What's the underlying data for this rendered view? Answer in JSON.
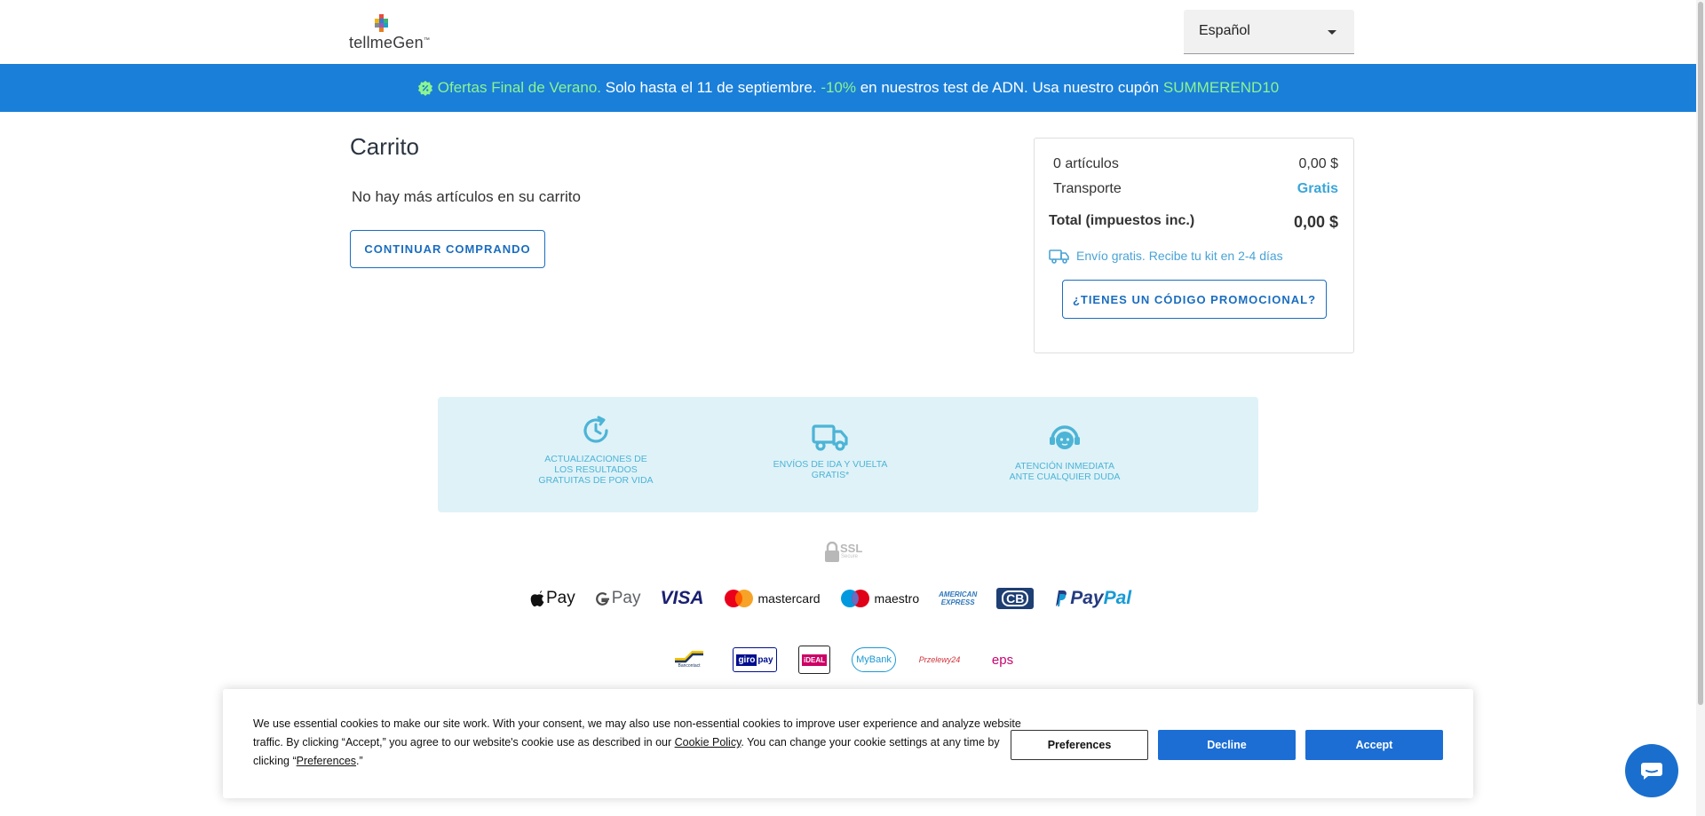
{
  "header": {
    "logo_text": "tellmeGen",
    "logo_tm": "™",
    "language": {
      "selected": "Español"
    }
  },
  "banner": {
    "icon": "percent-badge-icon",
    "highlight": "Ofertas Final de Verano.",
    "text1": " Solo hasta el 11 de septiembre. ",
    "discount": "-10%",
    "text2": " en nuestros test de ADN. Usa nuestro cupón ",
    "coupon": "SUMMEREND10",
    "colors": {
      "background": "#1a7fd9",
      "accent": "#8bf58f"
    }
  },
  "cart": {
    "title": "Carrito",
    "empty_message": "No hay más artículos en su carrito",
    "continue_label": "CONTINUAR COMPRANDO"
  },
  "summary": {
    "items_label": "0 artículos",
    "items_value": "0,00 $",
    "shipping_label": "Transporte",
    "shipping_value": "Gratis",
    "total_label": "Total (impuestos inc.)",
    "total_value": "0,00 $",
    "shipping_note": "Envío gratis. Recibe tu kit en 2-4 días",
    "promo_label": "¿TIENES UN CÓDIGO PROMOCIONAL?"
  },
  "features": [
    {
      "icon": "clock-refresh-icon",
      "line1": "ACTUALIZACIONES DE",
      "line2": "LOS RESULTADOS",
      "line3": "GRATUITAS DE POR VIDA"
    },
    {
      "icon": "truck-icon",
      "line1": "ENVÍOS DE IDA Y VUELTA",
      "line2": "GRATIS*"
    },
    {
      "icon": "support-agent-icon",
      "line1": "ATENCIÓN INMEDIATA",
      "line2": "ANTE CUALQUIER DUDA"
    }
  ],
  "security": {
    "ssl_label": "SSL",
    "ssl_sub": "Secure"
  },
  "payments_row1": {
    "apple_pay": "Pay",
    "google_pay": "Pay",
    "visa": "VISA",
    "mastercard": "mastercard",
    "maestro": "maestro",
    "amex_line1": "AMERICAN",
    "amex_line2": "EXPRESS",
    "cb": "CB",
    "paypal_a": "Pay",
    "paypal_b": "Pal"
  },
  "payments_row2": {
    "bancontact": "Bancontact",
    "giropay_a": "giro",
    "giropay_b": "pay",
    "ideal": "iDEAL",
    "mybank": "MyBank",
    "przelewy": "Przelewy24",
    "eps": "eps"
  },
  "cookie": {
    "text_part1": "We use essential cookies to make our site work. With your consent, we may also use non-essential cookies to improve user experience and analyze website traffic. By clicking “Accept,” you agree to our website's cookie use as described in our ",
    "cookie_policy_link": "Cookie Policy",
    "text_part2": ". You can change your cookie settings at any time by clicking “",
    "preferences_link": "Preferences",
    "text_part3": ".”",
    "preferences_button": "Preferences",
    "decline_button": "Decline",
    "accept_button": "Accept"
  },
  "chat": {
    "icon": "chat-bubble-icon"
  }
}
